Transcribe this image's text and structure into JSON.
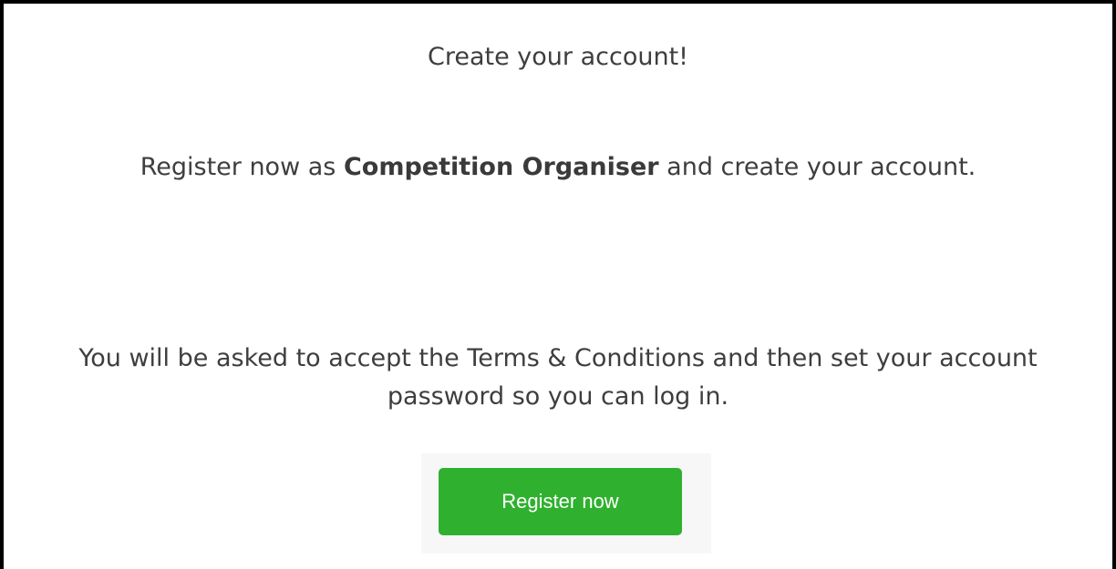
{
  "page": {
    "title": "Create your account!",
    "intro": {
      "before": "Register now as ",
      "role": "Competition Organiser",
      "after": " and create your account."
    },
    "notice": "You will be asked to accept the Terms & Conditions and then set your account password so you can log in."
  },
  "cta": {
    "label": "Register now",
    "color": "#2fb12f"
  },
  "colors": {
    "text": "#3e3e3e",
    "frame_border": "#000000",
    "button_panel": "#f7f7f7"
  }
}
